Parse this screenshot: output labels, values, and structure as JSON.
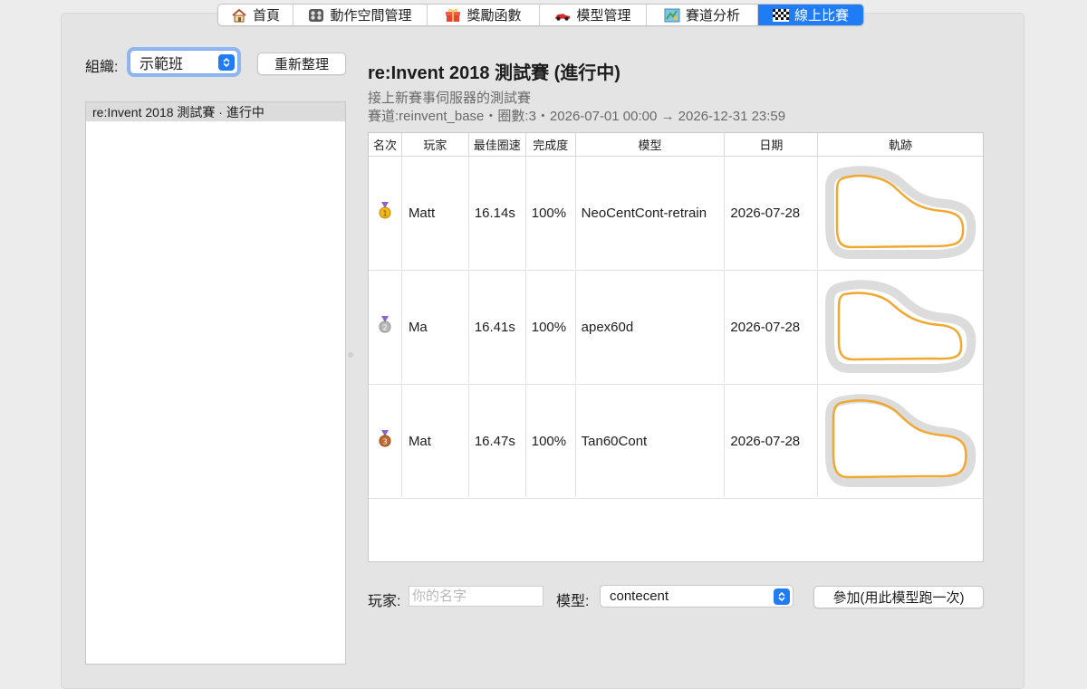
{
  "tabs": [
    {
      "label": "首頁",
      "icon": "house-icon",
      "active": false
    },
    {
      "label": "動作空間管理",
      "icon": "gamepad-icon",
      "active": false
    },
    {
      "label": "獎勵函數",
      "icon": "gift-icon",
      "active": false
    },
    {
      "label": "模型管理",
      "icon": "race-car-icon",
      "active": false
    },
    {
      "label": "賽道分析",
      "icon": "map-icon",
      "active": false
    },
    {
      "label": "線上比賽",
      "icon": "checkered-flag-icon",
      "active": true
    }
  ],
  "org": {
    "label": "組織:",
    "value": "示範班"
  },
  "refresh_label": "重新整理",
  "races": [
    {
      "label": "re:Invent 2018 測試賽  ·  進行中"
    }
  ],
  "race": {
    "title": "re:Invent 2018 測試賽  (進行中)",
    "subtitle": "接上新賽事伺服器的測試賽",
    "meta": "賽道:reinvent_base・圈數:3・2026-07-01 00:00 → 2026-12-31 23:59"
  },
  "table": {
    "headers": [
      "名次",
      "玩家",
      "最佳圈速",
      "完成度",
      "模型",
      "日期",
      "軌跡"
    ],
    "rows": [
      {
        "medal": "gold-medal-icon",
        "medal_color": "#f2b51a",
        "medal_num": "1",
        "player": "Matt",
        "lap": "16.14s",
        "completion": "100%",
        "model": "NeoCentCont-retrain",
        "date": "2026-07-28"
      },
      {
        "medal": "silver-medal-icon",
        "medal_color": "#a8a8a8",
        "medal_num": "2",
        "player": "Ma",
        "lap": "16.41s",
        "completion": "100%",
        "model": "apex60d",
        "date": "2026-07-28"
      },
      {
        "medal": "bronze-medal-icon",
        "medal_color": "#c06a2d",
        "medal_num": "3",
        "player": "Mat",
        "lap": "16.47s",
        "completion": "100%",
        "model": "Tan60Cont",
        "date": "2026-07-28"
      }
    ]
  },
  "form": {
    "player_label": "玩家:",
    "player_placeholder": "你的名字",
    "model_label": "模型:",
    "model_value": "contecent",
    "join_label": "參加(用此模型跑一次)"
  },
  "colors": {
    "accent": "#1f7cf5",
    "trajectory": "#f0a830",
    "track": "#dcdcdc"
  }
}
